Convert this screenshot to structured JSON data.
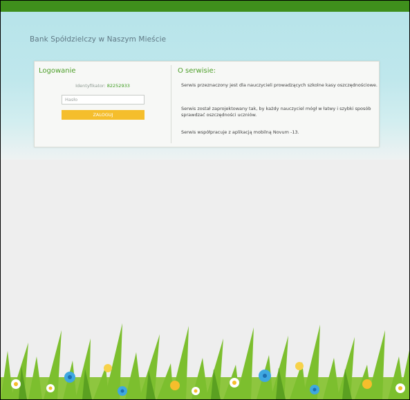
{
  "header": {
    "bank_name": "Bank Spółdzielczy w Naszym Mieście"
  },
  "login": {
    "title": "Logowanie",
    "identifier_label": "Identyfikator:",
    "identifier_value": "82252933",
    "password_placeholder": "Hasło",
    "button_label": "ZALOGUJ"
  },
  "about": {
    "title": "O serwisie:",
    "paragraphs": [
      "Serwis przeznaczony jest dla nauczycieli prowadzących szkolne kasy oszczędnościowe.",
      "Serwis został zaprojektowany tak, by każdy nauczyciel mógł w łatwy i szybki sposób sprawdzać oszczędności uczniów.",
      "Serwis współpracuje z aplikacją mobilną Novum -13."
    ]
  },
  "colors": {
    "top_bar": "#3f8f1c",
    "accent_green": "#4c9e28",
    "login_button": "#f5be2c"
  }
}
